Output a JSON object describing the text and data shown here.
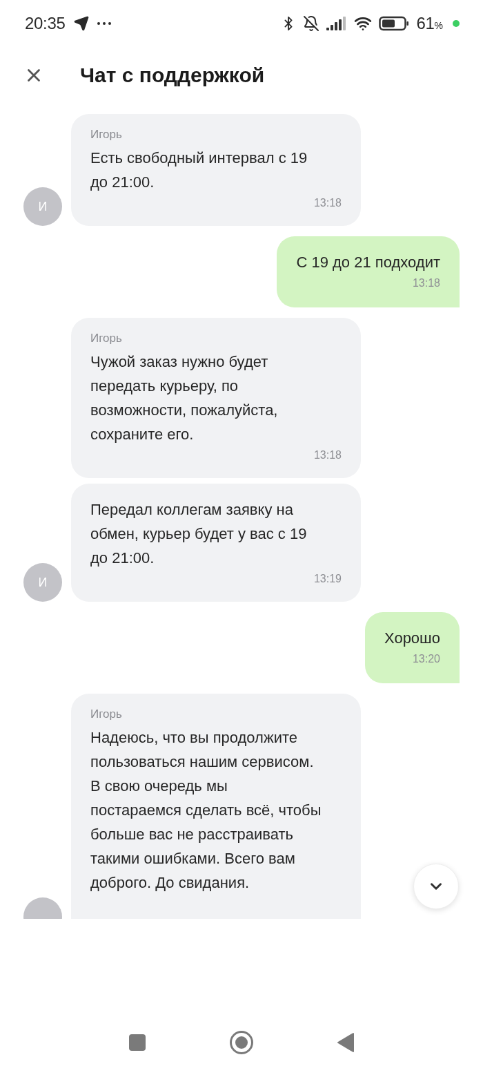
{
  "status_bar": {
    "time": "20:35",
    "battery_percent": "61",
    "percent_sign": "%"
  },
  "header": {
    "title": "Чат с поддержкой"
  },
  "messages": [
    {
      "kind": "incoming",
      "sender": "Игорь",
      "text": "Есть свободный интервал с 19\nдо 21:00.",
      "time": "13:18",
      "show_avatar": true,
      "avatar_letter": "И"
    },
    {
      "kind": "outgoing",
      "text": "С 19 до 21 подходит",
      "time": "13:18"
    },
    {
      "kind": "incoming",
      "sender": "Игорь",
      "text": "Чужой заказ нужно будет\nпередать курьеру, по\nвозможности, пожалуйста,\nсохраните его.",
      "time": "13:18",
      "show_avatar": false
    },
    {
      "kind": "incoming",
      "text": "Передал коллегам заявку на\nобмен, курьер будет у вас с 19\nдо 21:00.",
      "time": "13:19",
      "show_avatar": true,
      "avatar_letter": "И"
    },
    {
      "kind": "outgoing",
      "text": "Хорошо",
      "time": "13:20"
    },
    {
      "kind": "incoming",
      "sender": "Игорь",
      "text": "Надеюсь, что вы продолжите\nпользоваться нашим сервисом.\nВ свою очередь мы\nпостараемся сделать всё, чтобы\nбольше вас не расстраивать\nтакими ошибками. Всего вам\nдоброго. До свидания.",
      "show_avatar": true
    }
  ]
}
